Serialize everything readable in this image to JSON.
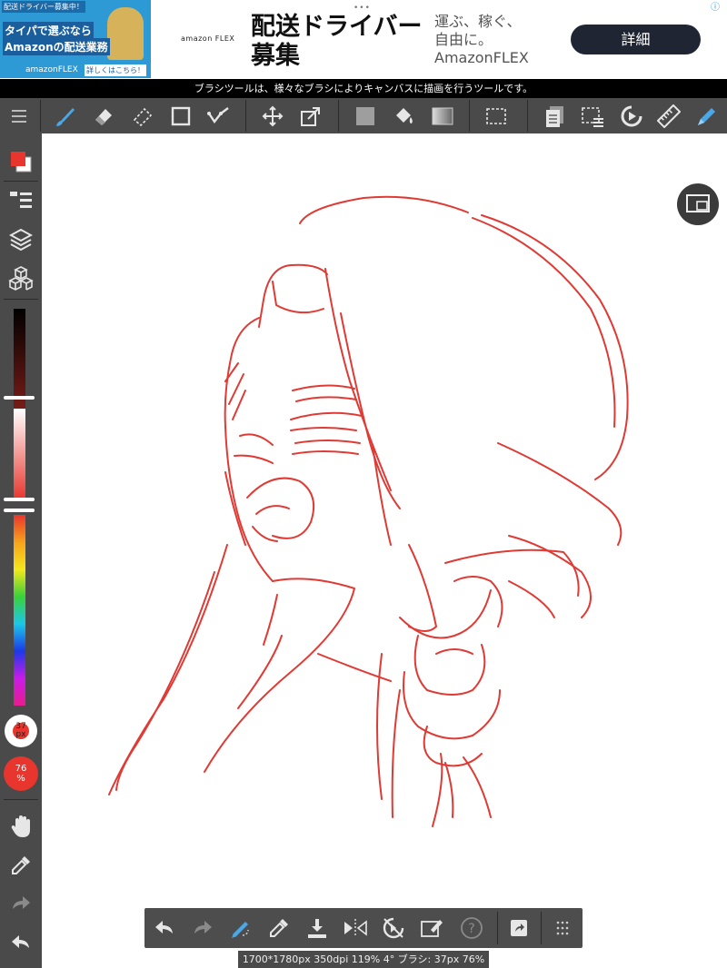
{
  "ad": {
    "thumb_label_1": "配送ドライバー募集中！",
    "thumb_label_2": "タイパで選ぶなら",
    "thumb_label_3": "Amazonの配送業務",
    "thumb_label_4": "amazonFLEX",
    "thumb_label_5": "詳しくはこちら！",
    "brand_small": "amazon FLEX",
    "headline_line1": "配送ドライバー",
    "headline_line2": "募集",
    "sub_line1": "運ぶ、稼ぐ、",
    "sub_line2": "自由に。",
    "sub_line3": "AmazonFLEX",
    "cta": "詳細",
    "dots": "•••",
    "info": "ⓘ"
  },
  "hint": "ブラシツールは、様々なブラシによりキャンバスに描画を行うツールです。",
  "toolbar": {
    "active_color": "#4aa8e8",
    "icon_color": "#e6e6e6"
  },
  "sidebar": {
    "brush_size": "37\npx",
    "opacity": "76\n%",
    "primary_color": "#e8352d"
  },
  "status": "1700*1780px 350dpi 119% 4° ブラシ: 37px 76%",
  "colors": {
    "stroke": "#e03a34",
    "panel": "#4a4a4a"
  }
}
